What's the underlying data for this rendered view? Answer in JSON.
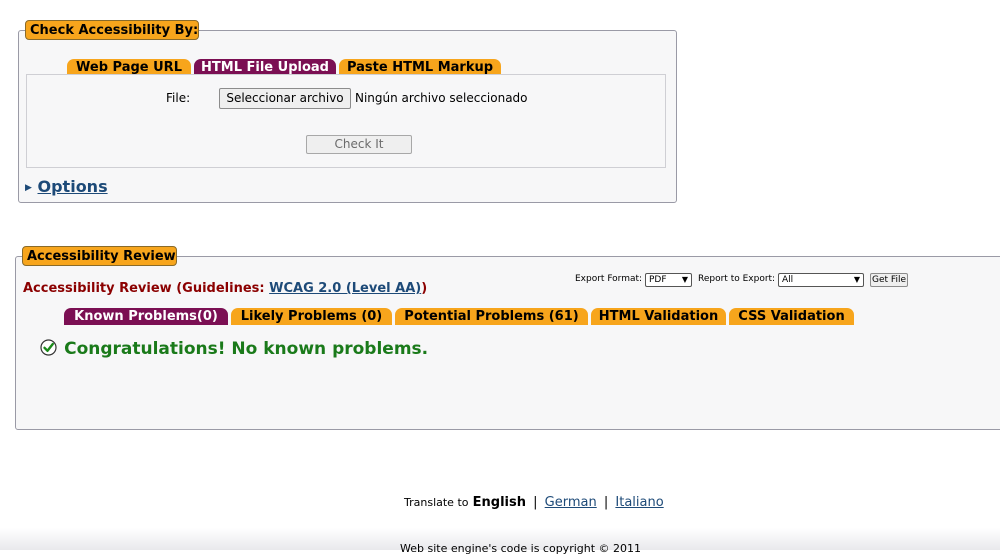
{
  "check_section": {
    "legend": "Check Accessibility By:",
    "tabs": [
      {
        "label": "Web Page URL",
        "active": false
      },
      {
        "label": "HTML File Upload",
        "active": true
      },
      {
        "label": "Paste HTML Markup",
        "active": false
      }
    ],
    "file_label": "File:",
    "choose_button": "Seleccionar archivo",
    "no_file_text": "Ningún archivo seleccionado",
    "check_button": "Check It",
    "options_link": "Options"
  },
  "review_section": {
    "legend": "Accessibility Review",
    "heading_prefix": "Accessibility Review (Guidelines: ",
    "guideline_link": "WCAG 2.0 (Level AA)",
    "heading_suffix": ")",
    "export_format_label": "Export Format:",
    "export_format_value": "PDF",
    "report_label": "Report to Export:",
    "report_value": "All",
    "get_file_button": "Get File",
    "tabs": [
      {
        "label": "Known Problems(0)",
        "active": true
      },
      {
        "label": "Likely Problems (0)",
        "active": false
      },
      {
        "label": "Potential Problems (61)",
        "active": false
      },
      {
        "label": "HTML Validation",
        "active": false
      },
      {
        "label": "CSS Validation",
        "active": false
      }
    ],
    "result_message": "Congratulations! No known problems."
  },
  "translate": {
    "prefix": "Translate to",
    "current": "English",
    "sep1": "|",
    "german": "German",
    "sep2": "|",
    "italian": "Italiano"
  },
  "footer_text": "Web site engine's code is copyright © 2011",
  "colors": {
    "tab_orange": "#f7a51c",
    "tab_active": "#7b0f53",
    "heading_red": "#8b0000",
    "success_green": "#1a7a1a",
    "link_blue": "#1d4a78"
  }
}
